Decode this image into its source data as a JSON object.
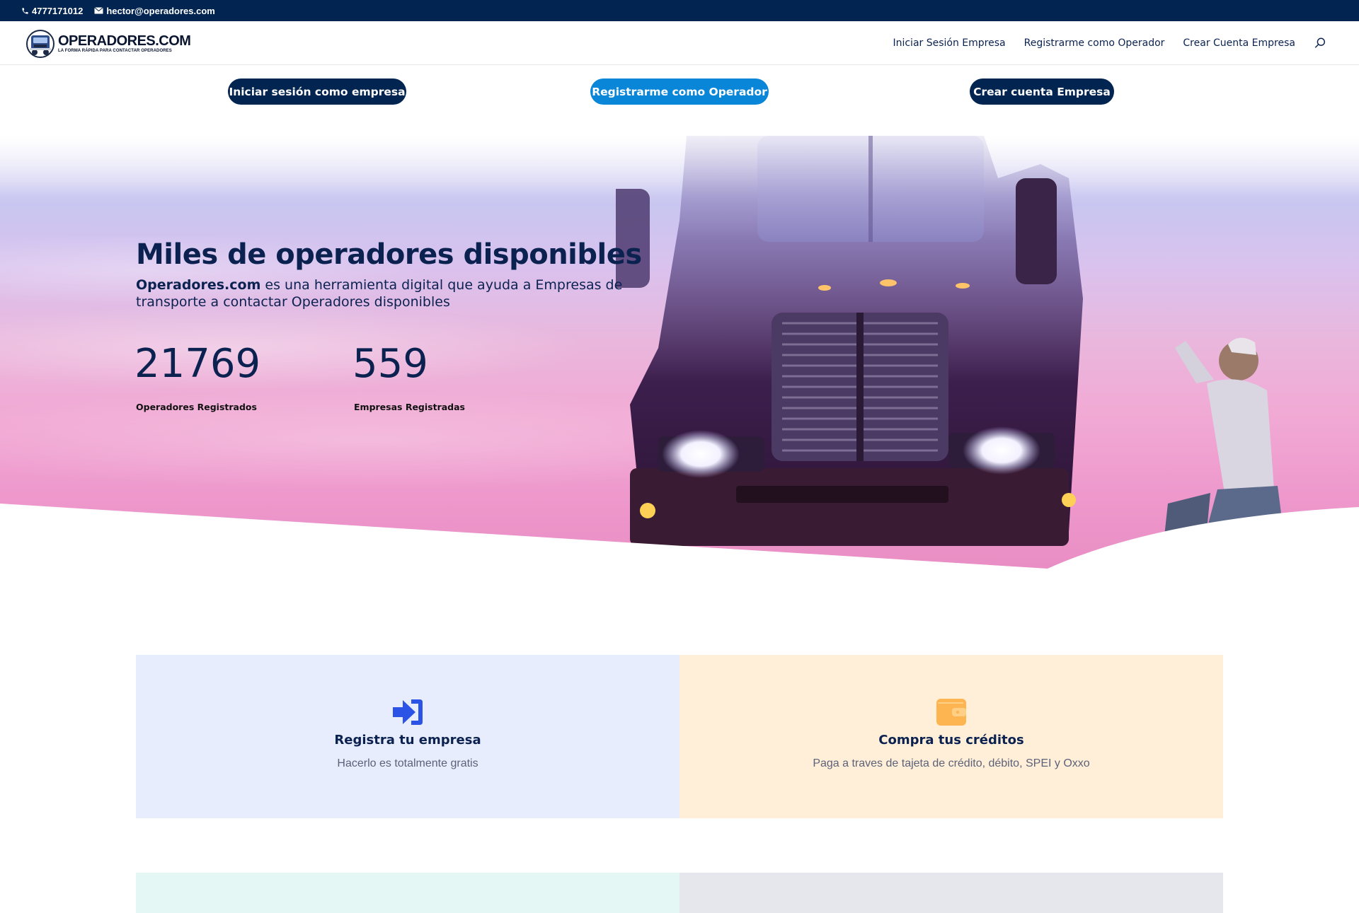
{
  "topbar": {
    "phone": "4777171012",
    "email": "hector@operadores.com",
    "icons": {
      "phone": "phone-icon",
      "email": "envelope-icon"
    }
  },
  "header": {
    "logo_title": "OPERADORES.COM",
    "logo_subtitle": "LA FORMA RÁPIDA PARA CONTACTAR OPERADORES",
    "nav": [
      {
        "label": "Iniciar Sesión Empresa"
      },
      {
        "label": "Registrarme como Operador"
      },
      {
        "label": "Crear Cuenta Empresa"
      }
    ],
    "search_icon": "search-icon"
  },
  "cta_buttons": [
    {
      "label": "Iniciar sesión como empresa",
      "color": "#022450"
    },
    {
      "label": "Registrarme como Operador",
      "color": "#0a86d8"
    },
    {
      "label": "Crear cuenta Empresa",
      "color": "#022450"
    }
  ],
  "hero": {
    "title": "Miles de operadores disponibles",
    "desc_bold": "Operadores.com",
    "desc_rest": " es una herramienta digital que ayuda a Empresas de transporte a contactar Operadores disponibles",
    "stats": [
      {
        "value": "21769",
        "label": "Operadores Registrados"
      },
      {
        "value": "559",
        "label": "Empresas Registradas"
      }
    ]
  },
  "cards": [
    {
      "title": "Registra tu empresa",
      "text": "Hacerlo es totalmente gratis",
      "icon": "sign-in-icon",
      "icon_color": "#2b53e6",
      "bg": "#e7edfd"
    },
    {
      "title": "Compra tus créditos",
      "text": "Paga a traves de tajeta de crédito, débito, SPEI y Oxxo",
      "icon": "wallet-icon",
      "icon_color": "#fdb552",
      "bg": "#ffefd9"
    }
  ],
  "colors": {
    "navy": "#022450",
    "text": "#0b2250",
    "accent_blue": "#0a86d8"
  }
}
